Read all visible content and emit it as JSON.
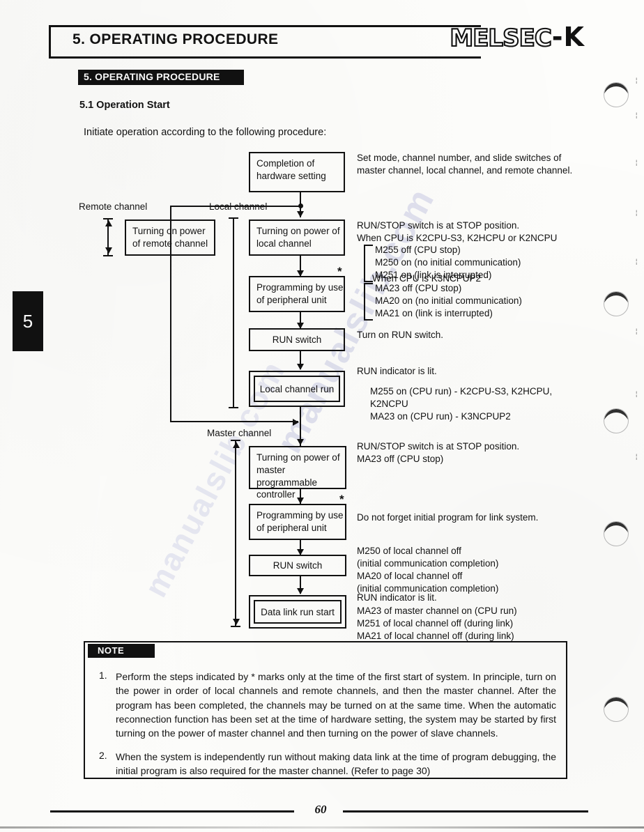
{
  "header": {
    "title": "5. OPERATING PROCEDURE",
    "brand_main": "MELSEC",
    "brand_dash": "-",
    "brand_suffix": "K"
  },
  "section": {
    "banner": "5. OPERATING PROCEDURE",
    "subheading": "5.1 Operation Start",
    "intro": "Initiate operation according to the following procedure:"
  },
  "chapter_tab": {
    "number": "5"
  },
  "flowchart": {
    "boxes": [
      {
        "id": "completion",
        "text": "Completion of\nhardware setting"
      },
      {
        "id": "remote_power",
        "text": "Turning on power\nof remote channel"
      },
      {
        "id": "local_power",
        "text": "Turning on power of\nlocal channel"
      },
      {
        "id": "local_prog",
        "text": "Programming by use\nof peripheral unit"
      },
      {
        "id": "local_run_sw",
        "text": "RUN switch"
      },
      {
        "id": "local_run",
        "text": "Local channel run"
      },
      {
        "id": "master_power",
        "text": "Turning on power of\nmaster programmable\ncontroller"
      },
      {
        "id": "master_prog",
        "text": "Programming by use\nof peripheral unit"
      },
      {
        "id": "master_run_sw",
        "text": "RUN switch"
      },
      {
        "id": "datalink_start",
        "text": "Data link run start"
      }
    ],
    "labels": {
      "remote_channel": "Remote channel",
      "local_channel": "Local channel",
      "master_channel": "Master channel"
    },
    "star_mark": "*"
  },
  "annotations": {
    "hardware": "Set mode, channel number, and slide switches of\nmaster channel, local channel, and remote channel.",
    "local_power_head": "RUN/STOP switch is at STOP position.\nWhen CPU is K2CPU-S3, K2HCPU or K2NCPU",
    "k2_relays": "M255 off (CPU stop)\nM250 on (no initial communication)\nM251 on (link is interrupted)",
    "k3_head": "When CPU is K3NCPUP2",
    "k3_relays": "MA23 off (CPU stop)\nMA20 on (no initial communication)\nMA21 on (link is interrupted)",
    "local_run_switch": "Turn on RUN switch.",
    "local_run_head": "RUN indicator is lit.",
    "local_run_relays": "M255 on (CPU run) - K2CPU-S3, K2HCPU,\nK2NCPU\nMA23 on (CPU run) - K3NCPUP2",
    "master_power": "RUN/STOP switch is at STOP position.\n     MA23 off (CPU stop)",
    "master_prog": "Do not forget initial program for link system.",
    "master_run_switch": "M250 of local channel off\n(initial communication completion)\nMA20 of local channel off\n(initial communication completion)",
    "datalink_head": "RUN indicator is lit.",
    "datalink_relays": "MA23 of master channel on (CPU run)\nM251 of local channel off (during link)\nMA21 of local channel off (during link)"
  },
  "note": {
    "tag": "NOTE",
    "items": [
      {
        "number": "1.",
        "text": "Perform the steps indicated by * marks only at the time of the first start of system. In principle, turn on the power in order of local channels and remote channels, and then the master channel. After the program has been completed, the channels may be turned on at the same time. When the automatic reconnection function has been set at the time of hardware setting, the system may be started by first turning on the power of master channel and then turning on the power of slave channels."
      },
      {
        "number": "2.",
        "text": "When the system is independently run without making data link at the time of program debugging, the initial program is also required for the master channel. (Refer to page 30)"
      }
    ]
  },
  "footer": {
    "page_number": "60"
  },
  "watermark": {
    "text": "manualslib.com"
  },
  "colors": {
    "ink": "#111111",
    "paper": "#fdfdfb",
    "watermark": "#6c74be"
  }
}
